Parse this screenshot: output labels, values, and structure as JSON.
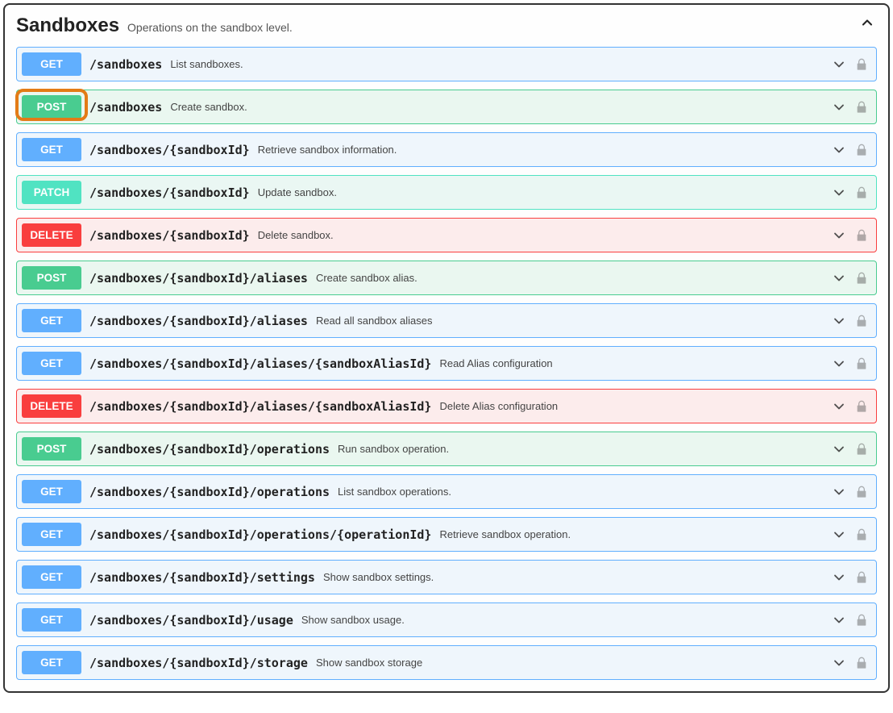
{
  "section": {
    "title": "Sandboxes",
    "description": "Operations on the sandbox level."
  },
  "methods": {
    "get": "GET",
    "post": "POST",
    "patch": "PATCH",
    "delete": "DELETE"
  },
  "endpoints": [
    {
      "method": "get",
      "path": "/sandboxes",
      "desc": "List sandboxes."
    },
    {
      "method": "post",
      "path": "/sandboxes",
      "desc": "Create sandbox.",
      "highlighted": true
    },
    {
      "method": "get",
      "path": "/sandboxes/{sandboxId}",
      "desc": "Retrieve sandbox information."
    },
    {
      "method": "patch",
      "path": "/sandboxes/{sandboxId}",
      "desc": "Update sandbox."
    },
    {
      "method": "delete",
      "path": "/sandboxes/{sandboxId}",
      "desc": "Delete sandbox."
    },
    {
      "method": "post",
      "path": "/sandboxes/{sandboxId}/aliases",
      "desc": "Create sandbox alias."
    },
    {
      "method": "get",
      "path": "/sandboxes/{sandboxId}/aliases",
      "desc": "Read all sandbox aliases"
    },
    {
      "method": "get",
      "path": "/sandboxes/{sandboxId}/aliases/{sandboxAliasId}",
      "desc": "Read Alias configuration"
    },
    {
      "method": "delete",
      "path": "/sandboxes/{sandboxId}/aliases/{sandboxAliasId}",
      "desc": "Delete Alias configuration"
    },
    {
      "method": "post",
      "path": "/sandboxes/{sandboxId}/operations",
      "desc": "Run sandbox operation."
    },
    {
      "method": "get",
      "path": "/sandboxes/{sandboxId}/operations",
      "desc": "List sandbox operations."
    },
    {
      "method": "get",
      "path": "/sandboxes/{sandboxId}/operations/{operationId}",
      "desc": "Retrieve sandbox operation."
    },
    {
      "method": "get",
      "path": "/sandboxes/{sandboxId}/settings",
      "desc": "Show sandbox settings."
    },
    {
      "method": "get",
      "path": "/sandboxes/{sandboxId}/usage",
      "desc": "Show sandbox usage."
    },
    {
      "method": "get",
      "path": "/sandboxes/{sandboxId}/storage",
      "desc": "Show sandbox storage"
    }
  ]
}
